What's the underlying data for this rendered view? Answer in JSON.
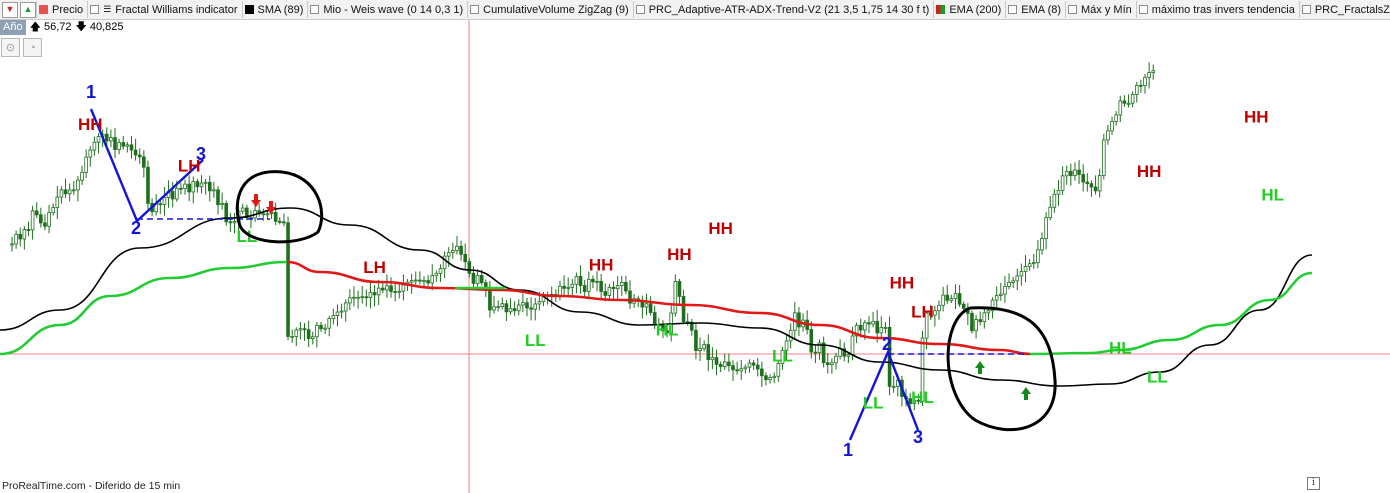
{
  "toolbar": {
    "buttons": [
      {
        "icon": "red-down-arrow-icon",
        "glyph": "▼",
        "color": "#cc2020"
      },
      {
        "icon": "green-up-arrow-icon",
        "glyph": "▲",
        "color": "#1a9a2a"
      }
    ],
    "indicators": [
      {
        "label": "Precio",
        "swatch": "#e45252"
      },
      {
        "label": "Fractal Williams indicator",
        "icon": "list-icon"
      },
      {
        "label": "SMA (89)",
        "swatch": "#000000"
      },
      {
        "label": "Mio - Weis wave (0 14 0,3 1)"
      },
      {
        "label": "CumulativeVolume ZigZag (9)"
      },
      {
        "label": "PRC_Adaptive-ATR-ADX-Trend-V2 (21 3,5 1,75 14 30 f t)"
      },
      {
        "label": "EMA (200)",
        "swatch": "#cc2020",
        "swatch2": "#1a9a2a"
      },
      {
        "label": "EMA (8)"
      },
      {
        "label": "Máx y Mín"
      },
      {
        "label": "máximo tras invers  tendencia"
      },
      {
        "label": "PRC_FractalsZigZ"
      }
    ]
  },
  "infobar": {
    "period": "Año",
    "high": "56,72",
    "low": "40,825"
  },
  "tools": [
    {
      "icon": "zoom-icon",
      "glyph": "⊙"
    },
    {
      "icon": "pie-chart-icon",
      "glyph": "◔"
    }
  ],
  "footer": "ProRealTime.com - Diferido de 15 min",
  "colors": {
    "hh": "#c00000",
    "ll": "#22cc22",
    "zigzag": "#1414d8",
    "sma": "#000000",
    "ema_down": "#e01818",
    "ema_up": "#22cc33",
    "candle": "#1f6f1f",
    "crosshair": "#f08080"
  },
  "chart_data": {
    "type": "candlestick",
    "ylim": [
      40.825,
      56.72
    ],
    "candles_close": [
      49.52,
      49.89,
      49.71,
      50.07,
      50.06,
      50.79,
      50.64,
      50.33,
      50.2,
      50.73,
      50.92,
      51.32,
      51.6,
      51.45,
      51.6,
      51.6,
      51.97,
      52.27,
      52.86,
      53.13,
      53.43,
      53.65,
      53.74,
      53.48,
      53.61,
      53.15,
      53.42,
      53.28,
      53.33,
      53.13,
      52.94,
      52.87,
      52.47,
      51.08,
      50.76,
      51.07,
      51.04,
      51.31,
      51.54,
      51.25,
      51.66,
      51.65,
      51.82,
      51.52,
      51.92,
      51.72,
      51.86,
      51.89,
      51.56,
      51.6,
      51.03,
      51.08,
      50.37,
      50.33,
      50.38,
      50.78,
      50.9,
      50.53,
      50.52,
      50.8,
      50.68,
      50.68,
      50.68,
      50.73,
      50.39,
      50.37,
      50.33,
      45.96,
      45.96,
      46.21,
      46.26,
      46.22,
      45.88,
      45.95,
      46.39,
      46.26,
      46.28,
      46.65,
      46.77,
      46.9,
      46.94,
      47.25,
      47.45,
      47.47,
      47.47,
      47.49,
      47.46,
      47.65,
      47.56,
      47.82,
      47.75,
      47.91,
      47.69,
      47.68,
      47.7,
      47.94,
      48.05,
      48.11,
      48.13,
      48.11,
      48.11,
      48.02,
      48.3,
      48.39,
      48.57,
      49.05,
      49.19,
      49.27,
      49.43,
      49.12,
      48.84,
      48.39,
      48.0,
      48.31,
      48.03,
      47.84,
      46.98,
      47.1,
      47.11,
      47.22,
      46.91,
      47.03,
      46.95,
      47.17,
      47.26,
      47.06,
      47.01,
      47.21,
      47.3,
      47.54,
      47.54,
      47.58,
      47.51,
      47.89,
      47.81,
      47.85,
      47.97,
      48.27,
      47.92,
      47.69,
      48.16,
      48.06,
      48.08,
      47.69,
      47.54,
      47.85,
      47.8,
      47.92,
      48.04,
      47.71,
      47.24,
      47.41,
      47.31,
      47.09,
      47.22,
      46.88,
      46.4,
      46.4,
      46.18,
      46.1,
      46.86,
      48.08,
      47.5,
      46.53,
      46.51,
      46.2,
      45.42,
      45.49,
      45.65,
      45.07,
      45.15,
      44.89,
      44.8,
      44.98,
      44.84,
      44.68,
      44.64,
      44.72,
      44.78,
      44.94,
      44.86,
      44.71,
      44.45,
      44.3,
      44.38,
      44.43,
      44.92,
      45.43,
      45.79,
      46.2,
      46.87,
      46.33,
      46.59,
      46.23,
      45.36,
      45.34,
      45.71,
      44.95,
      44.88,
      44.95,
      45.2,
      45.49,
      45.2,
      45.26,
      45.98,
      46.39,
      46.21,
      46.49,
      46.44,
      46.54,
      46.1,
      46.31,
      46.31,
      44.04,
      44.04,
      44.28,
      43.65,
      43.57,
      43.38,
      43.51,
      43.47,
      45.9,
      46.86,
      46.78,
      46.95,
      47.16,
      47.55,
      47.35,
      47.42,
      47.61,
      47.2,
      47.04,
      46.85,
      46.18,
      46.61,
      46.53,
      46.87,
      46.95,
      47.36,
      47.54,
      47.59,
      47.88,
      48.04,
      48.1,
      48.29,
      48.46,
      48.65,
      48.76,
      48.8,
      49.29,
      49.73,
      50.53,
      50.93,
      51.43,
      51.58,
      52.14,
      52.31,
      52.15,
      52.36,
      52.19,
      51.9,
      51.84,
      51.71,
      51.56,
      52.15,
      53.52,
      53.87,
      54.23,
      54.48,
      55.02,
      54.93,
      54.93,
      55.27,
      55.62,
      55.61,
      55.93,
      56.11,
      56.18
    ]
  },
  "annotations": {
    "labels": [
      {
        "t": "HH",
        "c": "hh",
        "n": 19,
        "p": 53.9
      },
      {
        "t": "LH",
        "c": "hh",
        "n": 43,
        "p": 52.3
      },
      {
        "t": "LL",
        "c": "ll",
        "n": 57,
        "p": 49.6
      },
      {
        "t": "LH",
        "c": "hh",
        "n": 88,
        "p": 48.4
      },
      {
        "t": "LL",
        "c": "ll",
        "n": 127,
        "p": 45.6
      },
      {
        "t": "HH",
        "c": "hh",
        "n": 143,
        "p": 48.5
      },
      {
        "t": "HL",
        "c": "ll",
        "n": 159,
        "p": 46.0
      },
      {
        "t": "HH",
        "c": "hh",
        "n": 162,
        "p": 48.9
      },
      {
        "t": "HH",
        "c": "hh",
        "n": 172,
        "p": 49.9
      },
      {
        "t": "LL",
        "c": "ll",
        "n": 187,
        "p": 45.0
      },
      {
        "t": "HH",
        "c": "hh",
        "n": 216,
        "p": 47.8
      },
      {
        "t": "LL",
        "c": "ll",
        "n": 278,
        "p": 44.2
      },
      {
        "t": "HH",
        "c": "hh",
        "n": 276,
        "p": 52.1
      },
      {
        "t": "LH",
        "c": "hh",
        "n": 221,
        "p": 46.7
      },
      {
        "t": "HL",
        "c": "ll",
        "n": 221,
        "p": 43.4
      },
      {
        "t": "LL",
        "c": "ll",
        "n": 209,
        "p": 43.2
      },
      {
        "t": "HL",
        "c": "ll",
        "n": 269,
        "p": 45.3
      },
      {
        "t": "HH",
        "c": "hh",
        "n": 302,
        "p": 54.2
      },
      {
        "t": "HL",
        "c": "ll",
        "n": 306,
        "p": 51.2
      }
    ],
    "zigzag_numbers": [
      "1",
      "2",
      "3"
    ]
  }
}
